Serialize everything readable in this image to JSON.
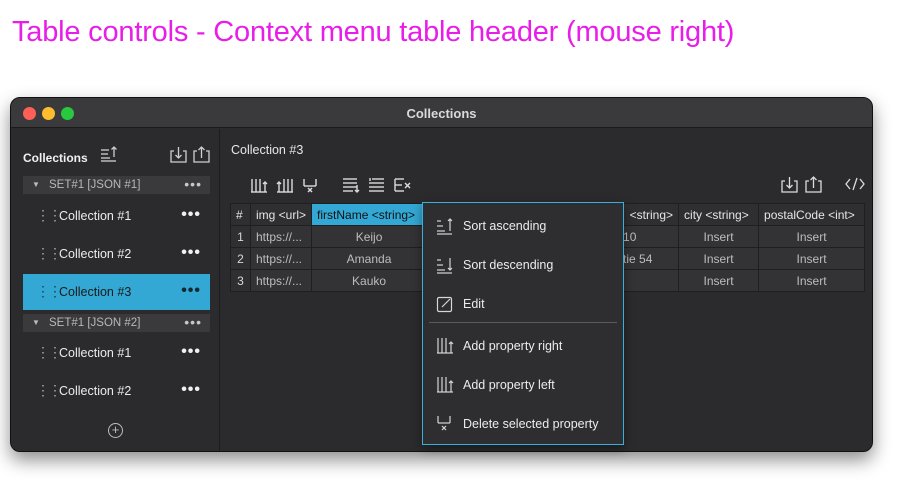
{
  "caption": "Table controls - Context menu table header (mouse right)",
  "window": {
    "title": "Collections"
  },
  "sidebar": {
    "title": "Collections",
    "sets": [
      {
        "label": "SET#1 [JSON #1]",
        "dots": "•••",
        "collections": [
          {
            "label": "Collection #1",
            "dots": "•••",
            "active": false
          },
          {
            "label": "Collection #2",
            "dots": "•••",
            "active": false
          },
          {
            "label": "Collection #3",
            "dots": "•••",
            "active": true
          }
        ]
      },
      {
        "label": "SET#1 [JSON #2]",
        "dots": "•••",
        "collections": [
          {
            "label": "Collection #1",
            "dots": "•••",
            "active": false
          },
          {
            "label": "Collection #2",
            "dots": "•••",
            "active": false
          }
        ]
      }
    ],
    "add_icon": "plus-circle-icon"
  },
  "main": {
    "title": "Collection #3",
    "toolbar_icons": [
      "add-column-right-icon",
      "add-column-left-icon",
      "delete-column-icon",
      "insert-row-below-icon",
      "insert-row-above-icon",
      "delete-row-icon",
      "import-icon",
      "export-icon",
      "code-icon"
    ]
  },
  "table": {
    "headers": [
      "#",
      "img <url>",
      "firstName <string>",
      "<string>",
      "city <string>",
      "postalCode <int>"
    ],
    "rows": [
      [
        "1",
        "https://...",
        "Keijo",
        "10",
        "Insert",
        "Insert"
      ],
      [
        "2",
        "https://...",
        "Amanda",
        "tie 54",
        "Insert",
        "Insert"
      ],
      [
        "3",
        "https://...",
        "Kauko",
        "",
        "Insert",
        "Insert"
      ]
    ]
  },
  "context_menu": {
    "items": [
      {
        "label": "Sort ascending",
        "icon": "sort-ascending-icon"
      },
      {
        "label": "Sort descending",
        "icon": "sort-descending-icon"
      },
      {
        "label": "Edit",
        "icon": "edit-icon"
      },
      {
        "label": "Add property right",
        "icon": "add-property-right-icon"
      },
      {
        "label": "Add property left",
        "icon": "add-property-left-icon"
      },
      {
        "label": "Delete selected property",
        "icon": "delete-property-icon"
      }
    ]
  },
  "colors": {
    "accent": "#33a8d4",
    "caption": "#e81ee8",
    "window_bg": "#2b2b2d"
  }
}
